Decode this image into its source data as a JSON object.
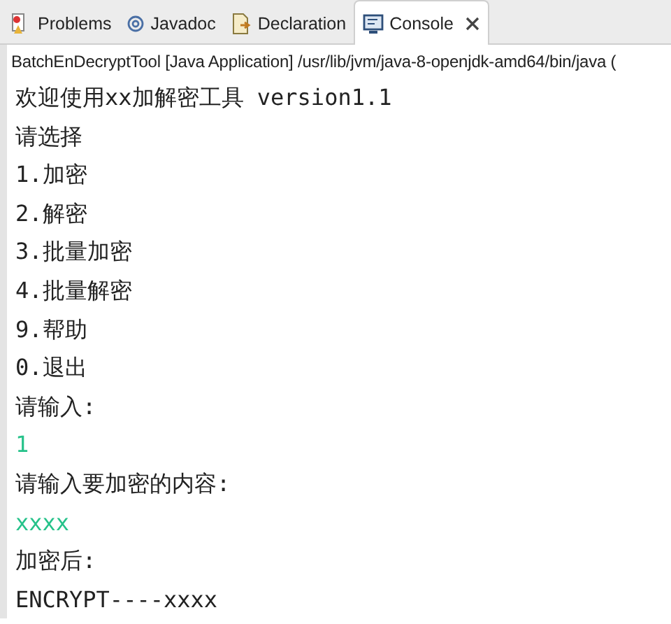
{
  "tabs": [
    {
      "label": "Problems",
      "selected": false
    },
    {
      "label": "Javadoc",
      "selected": false
    },
    {
      "label": "Declaration",
      "selected": false
    },
    {
      "label": "Console",
      "selected": true,
      "closable": true
    }
  ],
  "console": {
    "process": "BatchEnDecryptTool [Java Application] /usr/lib/jvm/java-8-openjdk-amd64/bin/java (",
    "lines": [
      {
        "text": "欢迎使用xx加解密工具 version1.1",
        "kind": "output"
      },
      {
        "text": "请选择",
        "kind": "output"
      },
      {
        "text": "1.加密",
        "kind": "output"
      },
      {
        "text": "2.解密",
        "kind": "output"
      },
      {
        "text": "3.批量加密",
        "kind": "output"
      },
      {
        "text": "4.批量解密",
        "kind": "output"
      },
      {
        "text": "9.帮助",
        "kind": "output"
      },
      {
        "text": "0.退出",
        "kind": "output"
      },
      {
        "text": "请输入:",
        "kind": "output"
      },
      {
        "text": "1",
        "kind": "input"
      },
      {
        "text": "请输入要加密的内容:",
        "kind": "output"
      },
      {
        "text": "xxxx",
        "kind": "input"
      },
      {
        "text": "加密后:",
        "kind": "output"
      },
      {
        "text": "ENCRYPT----xxxx",
        "kind": "output"
      }
    ]
  }
}
